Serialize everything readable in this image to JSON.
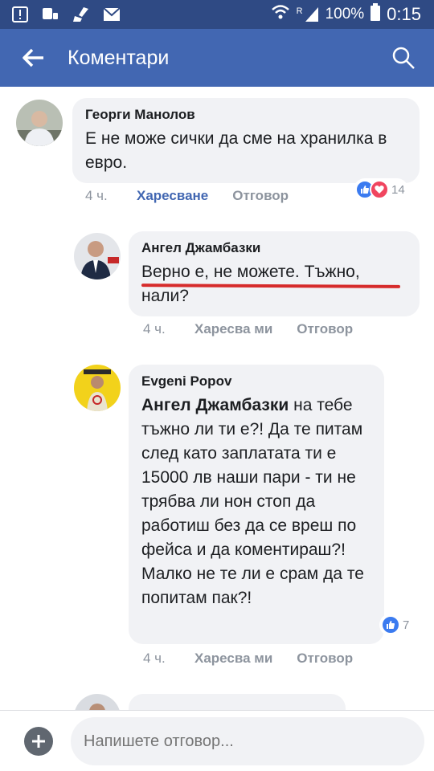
{
  "status_bar": {
    "battery": "100%",
    "time": "0:15",
    "network": "R"
  },
  "app_bar": {
    "title": "Коментари"
  },
  "comments": [
    {
      "author": "Георги Манолов",
      "text": "Е не може сички да сме на хранилка в евро.",
      "time": "4 ч.",
      "like_label": "Харесване",
      "reply_label": "Отговор",
      "reaction_count": "14"
    },
    {
      "author": "Ангел Джамбазки",
      "text_line1": "Верно е, не можете. Тъжно,",
      "text_line2": "нали?",
      "time": "4 ч.",
      "like_label": "Харесва ми",
      "reply_label": "Отговор"
    },
    {
      "author": "Evgeni Popov",
      "mention": "Ангел Джамбазки",
      "text_after_mention": " на тебе тъжно ли ти е?! Да те питам след като заплатата ти е 15000 лв наши пари - ти не трябва ли нон стоп да работиш без да се вреш по фейса и да коментираш?! Малко не те ли е срам да те попитам пак?!",
      "time": "4 ч.",
      "like_label": "Харесва ми",
      "reply_label": "Отговор",
      "reaction_count": "7"
    }
  ],
  "composer": {
    "placeholder": "Напишете отговор..."
  },
  "colors": {
    "brand": "#4267b2",
    "status_bar": "#2f4a84",
    "bubble": "#f1f2f5",
    "underline": "#d62b2b"
  }
}
